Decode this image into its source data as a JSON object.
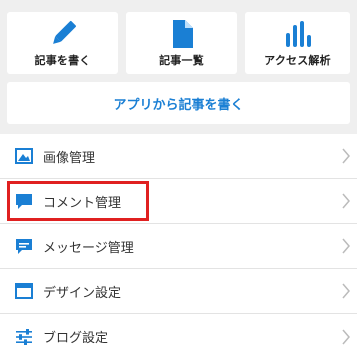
{
  "tiles": [
    {
      "label": "記事を書く",
      "icon": "pencil-icon"
    },
    {
      "label": "記事一覧",
      "icon": "document-icon"
    },
    {
      "label": "アクセス解析",
      "icon": "bar-chart-icon"
    }
  ],
  "app_button": {
    "label": "アプリから記事を書く"
  },
  "menu": [
    {
      "label": "画像管理",
      "icon": "image-icon"
    },
    {
      "label": "コメント管理",
      "icon": "comment-icon"
    },
    {
      "label": "メッセージ管理",
      "icon": "message-icon"
    },
    {
      "label": "デザイン設定",
      "icon": "window-icon"
    },
    {
      "label": "ブログ設定",
      "icon": "sliders-icon"
    }
  ],
  "colors": {
    "accent": "#1a7fd4",
    "highlight": "#e02020"
  }
}
